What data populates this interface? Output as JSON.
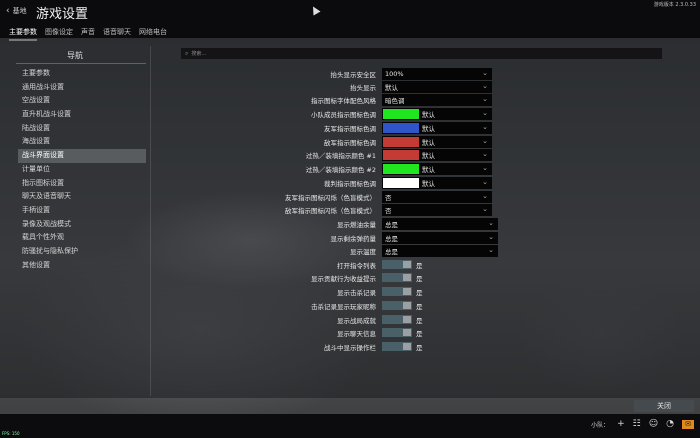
{
  "header": {
    "back_label": "基地",
    "title": "游戏设置",
    "version": "游戏版本 2.3.0.33",
    "tabs": [
      {
        "label": "主要参数",
        "active": true
      },
      {
        "label": "图像设定",
        "active": false
      },
      {
        "label": "声音",
        "active": false
      },
      {
        "label": "语音聊天",
        "active": false
      },
      {
        "label": "网络电台",
        "active": false
      }
    ]
  },
  "sidebar": {
    "heading": "导航",
    "items": [
      {
        "label": "主要参数"
      },
      {
        "label": "通用战斗设置"
      },
      {
        "label": "空战设置"
      },
      {
        "label": "直升机战斗设置"
      },
      {
        "label": "陆战设置"
      },
      {
        "label": "海战设置"
      },
      {
        "label": "战斗界面设置",
        "active": true
      },
      {
        "label": "计量单位"
      },
      {
        "label": "指示图标设置"
      },
      {
        "label": "聊天及语音聊天"
      },
      {
        "label": "手柄设置"
      },
      {
        "label": "录像及观战模式"
      },
      {
        "label": "载具个性外观"
      },
      {
        "label": "防骚扰与隐私保护"
      },
      {
        "label": "其他设置"
      }
    ]
  },
  "search": {
    "placeholder": "搜索..."
  },
  "settings": {
    "r0": {
      "label": "抬头显示安全区",
      "value": "100%"
    },
    "r1": {
      "label": "抬头显示",
      "value": "默认"
    },
    "r2": {
      "label": "指示图标字体配色风格",
      "value": "暗色调"
    },
    "r3": {
      "label": "小队成员指示图标色调",
      "value": "默认",
      "color": "#1fe61f"
    },
    "r4": {
      "label": "友军指示图标色调",
      "value": "默认",
      "color": "#2f55c8"
    },
    "r5": {
      "label": "敌军指示图标色调",
      "value": "默认",
      "color": "#c43a34"
    },
    "r6": {
      "label": "过热／装填指示颜色 #1",
      "value": "默认",
      "color": "#c43a34"
    },
    "r7": {
      "label": "过热／装填指示颜色 #2",
      "value": "默认",
      "color": "#1fe61f"
    },
    "r8": {
      "label": "裁判指示图标色调",
      "value": "默认",
      "color": "#ffffff"
    },
    "r9": {
      "label": "友军指示图标闪烁（色盲模式）",
      "value": "否"
    },
    "r10": {
      "label": "敌军指示图标闪烁（色盲模式）",
      "value": "否"
    },
    "r11": {
      "label": "显示燃油余量",
      "value": "总是"
    },
    "r12": {
      "label": "显示剩余弹药量",
      "value": "总是"
    },
    "r13": {
      "label": "显示温度",
      "value": "总是"
    },
    "r14": {
      "label": "打开指令列表",
      "value": "是"
    },
    "r15": {
      "label": "显示贡献行为收益提示",
      "value": "是"
    },
    "r16": {
      "label": "显示击杀记录",
      "value": "是"
    },
    "r17": {
      "label": "击杀记录显示玩家昵称",
      "value": "是"
    },
    "r18": {
      "label": "显示战局成就",
      "value": "是"
    },
    "r19": {
      "label": "显示聊天信息",
      "value": "是"
    },
    "r20": {
      "label": "战斗中显示操作栏",
      "value": "是"
    }
  },
  "footer": {
    "close_label": "关闭",
    "squad_label": "小队：",
    "fps": "FPS: 150"
  }
}
